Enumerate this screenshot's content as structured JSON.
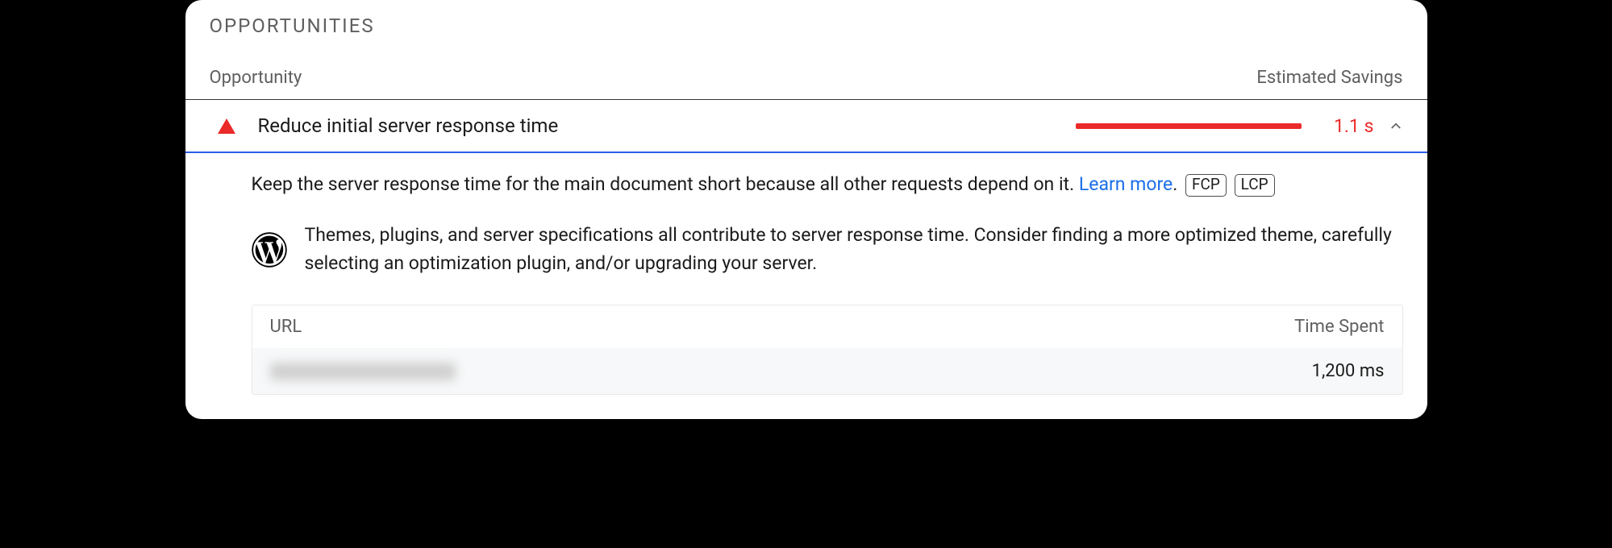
{
  "section_label": "OPPORTUNITIES",
  "columns": {
    "opportunity": "Opportunity",
    "savings": "Estimated Savings"
  },
  "opportunity": {
    "title": "Reduce initial server response time",
    "savings_value": "1.1 s",
    "description_pre": "Keep the server response time for the main document short because all other requests depend on it. ",
    "learn_more": "Learn more",
    "description_post": ". ",
    "tags": [
      "FCP",
      "LCP"
    ],
    "advice": "Themes, plugins, and server specifications all contribute to server response time. Consider finding a more optimized theme, carefully selecting an optimization plugin, and/or upgrading your server."
  },
  "table": {
    "col_url": "URL",
    "col_time": "Time Spent",
    "rows": [
      {
        "url_hidden": true,
        "time": "1,200 ms"
      }
    ]
  }
}
